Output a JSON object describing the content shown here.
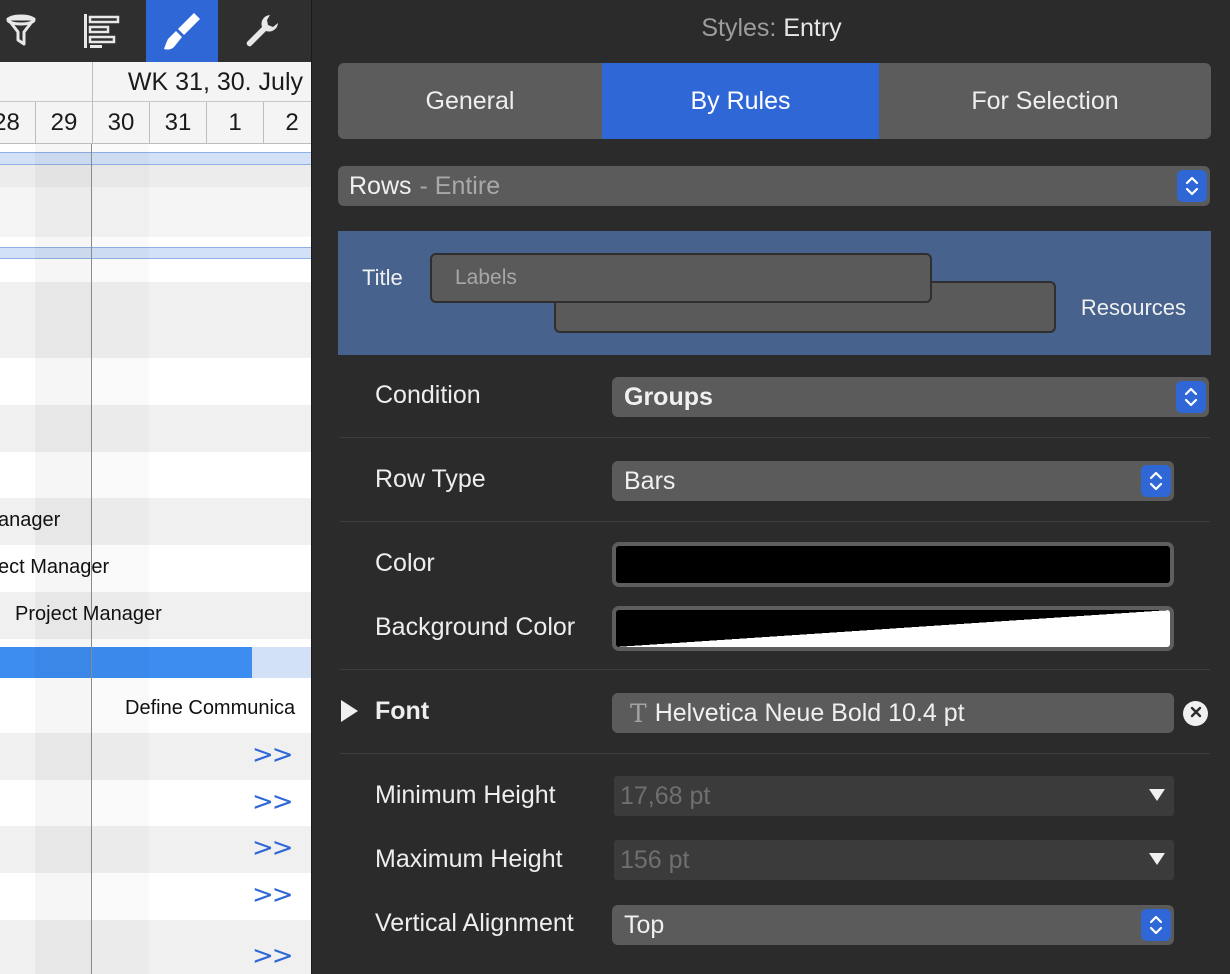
{
  "toolbar": {
    "icons": [
      "filter-icon",
      "outline-icon",
      "styles-brush-icon",
      "wrench-icon"
    ],
    "active": "styles-brush-icon"
  },
  "gantt": {
    "week_label": "WK 31, 30. July",
    "days": [
      "28",
      "29",
      "30",
      "31",
      "1",
      "2"
    ],
    "rows": {
      "manager_1": "anager",
      "manager_2": "ect Manager",
      "manager_3": "Project Manager",
      "define_task": "Define Communica",
      "arrow": ">>"
    },
    "progress_fraction": 0.81,
    "colors": {
      "accent": "#2f68d6",
      "group_band": "#d3e1f7"
    }
  },
  "inspector": {
    "title_label": "Styles:",
    "title_value": "Entry",
    "tabs": [
      {
        "label": "General",
        "active": false
      },
      {
        "label": "By Rules",
        "active": true
      },
      {
        "label": "For Selection",
        "active": false
      }
    ],
    "rows_popup": {
      "main": "Rows",
      "suffix": "- Entire"
    },
    "rule": {
      "title_label": "Title",
      "labels_placeholder": "Labels",
      "resources_label": "Resources"
    },
    "condition": {
      "label": "Condition",
      "value": "Groups"
    },
    "row_type": {
      "label": "Row Type",
      "value": "Bars"
    },
    "color": {
      "label": "Color",
      "value": "#000000"
    },
    "background_color": {
      "label": "Background Color",
      "value": "#000000 / #ffffff"
    },
    "font": {
      "label": "Font",
      "glyph": "T",
      "value": "Helvetica Neue Bold 10.4 pt"
    },
    "min_height": {
      "label": "Minimum Height",
      "value": "17,68 pt"
    },
    "max_height": {
      "label": "Maximum Height",
      "value": "156 pt"
    },
    "vertical_alignment": {
      "label": "Vertical Alignment",
      "value": "Top"
    },
    "colors": {
      "accent": "#2f68d6",
      "rule_box": "#46628d",
      "panel": "#2b2b2b"
    }
  }
}
